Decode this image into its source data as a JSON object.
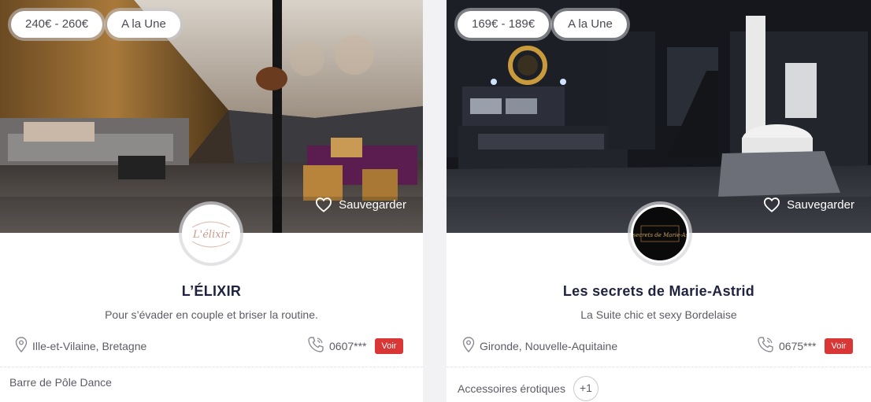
{
  "cards": [
    {
      "price": "240€ - 260€",
      "badge": "A la Une",
      "save_label": "Sauvegarder",
      "logo_text": "L'élixir",
      "title": "L’ÉLIXIR",
      "subtitle": "Pour s’évader en couple et briser la routine.",
      "location": "Ille-et-Vilaine, Bretagne",
      "phone": "0607***",
      "voir_label": "Voir",
      "tags": [
        "Barre de Pôle Dance"
      ],
      "more": ""
    },
    {
      "price": "169€ - 189€",
      "badge": "A la Une",
      "save_label": "Sauvegarder",
      "logo_text": "Les secrets de Marie-Astrid",
      "title": "Les secrets de Marie-Astrid",
      "subtitle": "La Suite chic et sexy Bordelaise",
      "location": "Gironde, Nouvelle-Aquitaine",
      "phone": "0675***",
      "voir_label": "Voir",
      "tags": [
        "Accessoires érotiques"
      ],
      "more": "+1"
    }
  ],
  "icons": {
    "save": "heart-icon",
    "location": "map-pin-icon",
    "phone": "phone-icon"
  },
  "colors": {
    "voir_button": "#d93636",
    "title": "#1f2340"
  }
}
